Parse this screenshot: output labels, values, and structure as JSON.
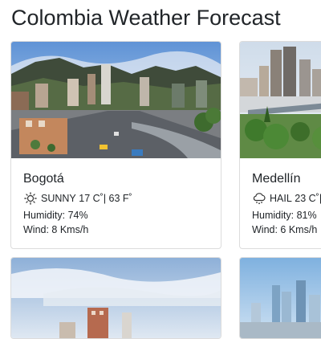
{
  "page": {
    "title": "Colombia Weather Forecast"
  },
  "cities": [
    {
      "name": "Bogotá",
      "condition": "SUNNY",
      "temperature": "17 C˚| 63 F˚",
      "humidity": "Humidity: 74%",
      "wind": "Wind: 8 Kms/h",
      "icon": "sun-icon"
    },
    {
      "name": "Medellín",
      "condition": "HAIL",
      "temperature": "23 C˚|",
      "humidity": "Humidity: 81%",
      "wind": "Wind: 6 Kms/h",
      "icon": "hail-icon"
    }
  ],
  "colors": {
    "card_border": "#dcdcdc",
    "text": "#212529",
    "sky": "#8db4e2"
  }
}
